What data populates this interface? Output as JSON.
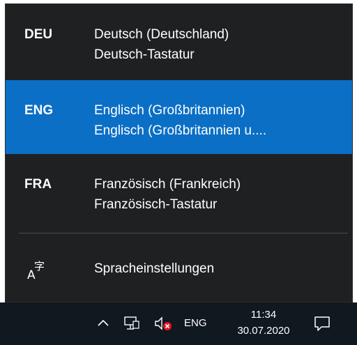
{
  "languages": [
    {
      "code": "DEU",
      "name": "Deutsch (Deutschland)",
      "layout": "Deutsch-Tastatur",
      "selected": false
    },
    {
      "code": "ENG",
      "name": "Englisch (Großbritannien)",
      "layout": "Englisch (Großbritannien u....",
      "selected": true
    },
    {
      "code": "FRA",
      "name": "Französisch (Frankreich)",
      "layout": "Französisch-Tastatur",
      "selected": false
    }
  ],
  "settings": {
    "label": "Spracheinstellungen",
    "icon": "language-settings-icon"
  },
  "taskbar": {
    "language": "ENG",
    "time": "11:34",
    "date": "30.07.2020",
    "icons": [
      "chevron-up-icon",
      "network-icon",
      "volume-muted-icon",
      "notification-icon"
    ]
  },
  "colors": {
    "flyout_bg": "#1f2022",
    "selected_bg": "#0b6fc6",
    "taskbar_bg": "#101820",
    "mute_badge": "#e81123"
  }
}
